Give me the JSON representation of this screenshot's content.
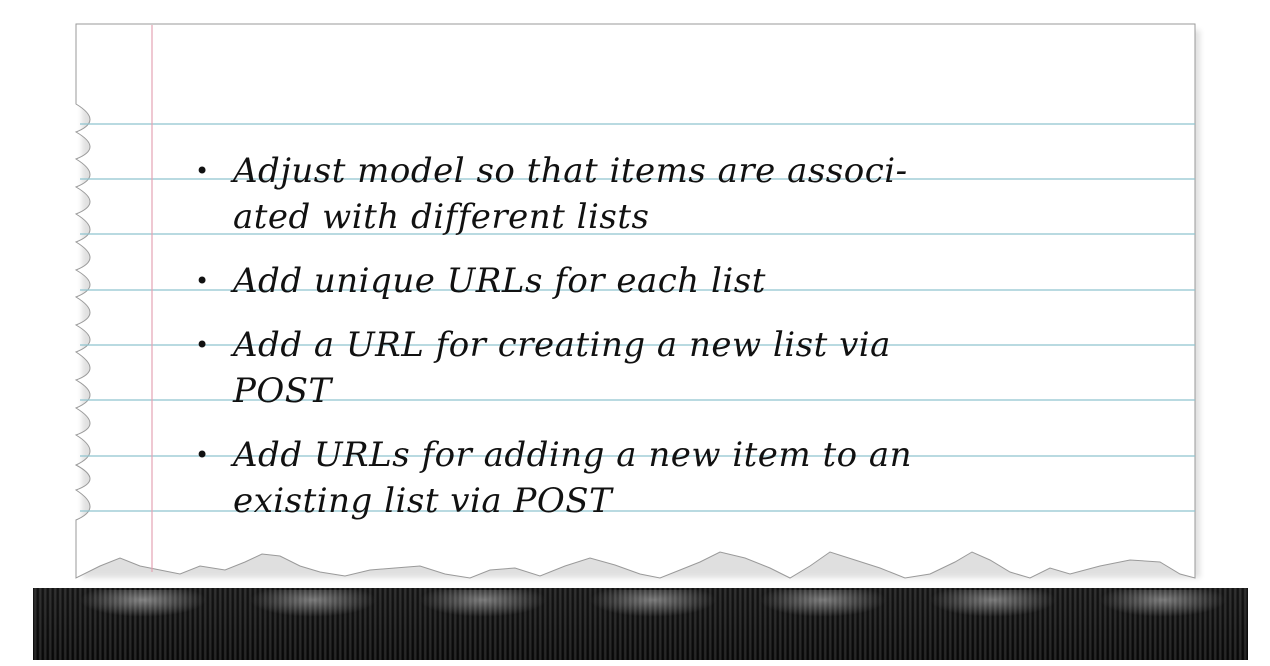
{
  "note": {
    "items": [
      "Adjust model so that items are associ-ated with different lists",
      "Add unique URLs for each list",
      "Add a URL for creating a new list via POST",
      "Add URLs for adding a new item to an existing list via POST"
    ]
  },
  "colors": {
    "paper": "#ffffff",
    "rule_line": "#8fc4cf",
    "margin_line": "#e4a3b3",
    "ink": "#111111",
    "edge": "#9a9a9a"
  },
  "icons": {
    "bullet": "bullet-dot-icon"
  }
}
